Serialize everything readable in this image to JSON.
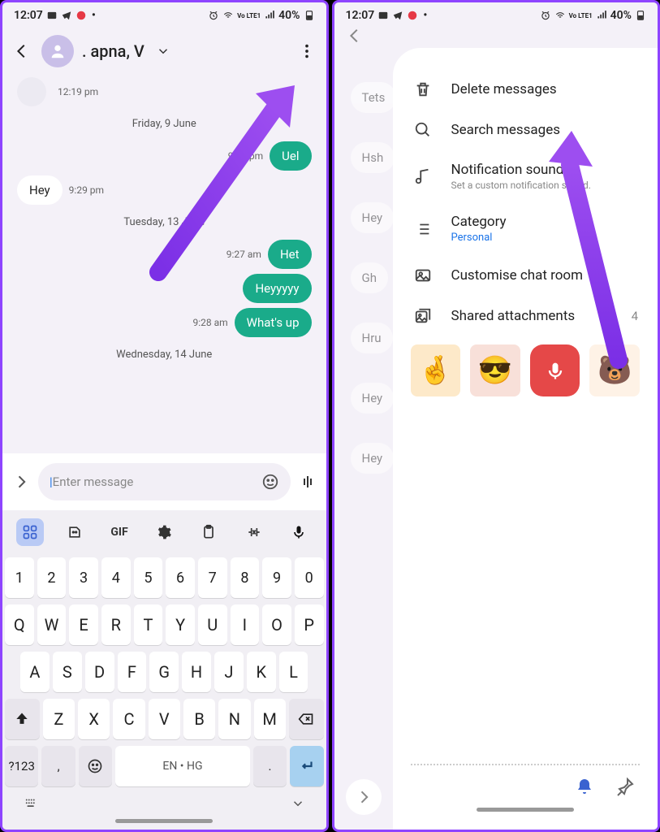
{
  "status": {
    "time": "12:07",
    "battery": "40%",
    "net": "Vo LTE1"
  },
  "left": {
    "header": {
      "title": ". apna, V"
    },
    "timeline": [
      {
        "kind": "smalltime",
        "text": "12:19 pm"
      },
      {
        "kind": "date",
        "text": "Friday, 9 June"
      },
      {
        "kind": "out",
        "text": "Uel",
        "ts": "9:19 pm"
      },
      {
        "kind": "in",
        "text": "Hey",
        "ts": "9:29 pm"
      },
      {
        "kind": "date",
        "text": "Tuesday, 13 June"
      },
      {
        "kind": "out",
        "text": "Het",
        "ts": "9:27 am"
      },
      {
        "kind": "out",
        "text": "Heyyyyy",
        "ts": ""
      },
      {
        "kind": "out",
        "text": "What's up",
        "ts": "9:28 am"
      },
      {
        "kind": "date",
        "text": "Wednesday, 14 June"
      }
    ],
    "input": {
      "placeholder": "Enter message"
    },
    "kbd": {
      "numrow": [
        "1",
        "2",
        "3",
        "4",
        "5",
        "6",
        "7",
        "8",
        "9",
        "0"
      ],
      "r1": [
        "Q",
        "W",
        "E",
        "R",
        "T",
        "Y",
        "U",
        "I",
        "O",
        "P"
      ],
      "r2": [
        "A",
        "S",
        "D",
        "F",
        "G",
        "H",
        "J",
        "K",
        "L"
      ],
      "r3": [
        "Z",
        "X",
        "C",
        "V",
        "B",
        "N",
        "M"
      ],
      "symkey": "?123",
      "langkey": "EN • HG",
      "comma": ",",
      "dot": "."
    }
  },
  "right": {
    "bgmsgs": [
      "Tets",
      "Hsh",
      "Hey",
      "Gh",
      "Hru",
      "Hey",
      "Hey"
    ],
    "menu": {
      "delete": "Delete messages",
      "search": "Search messages",
      "notif_title": "Notification sound",
      "notif_sub": "Set a custom notification sound.",
      "cat_title": "Category",
      "cat_value": "Personal",
      "custom": "Customise chat room",
      "shared": "Shared attachments",
      "shared_count": "4"
    }
  }
}
